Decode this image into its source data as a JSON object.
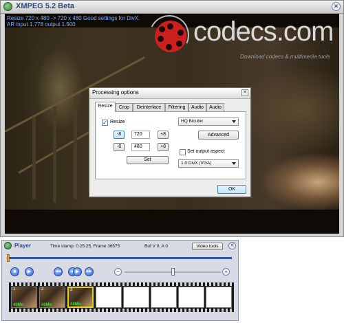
{
  "main_window": {
    "title": "XMPEG 5.2 Beta",
    "info_line1": "Resize 720 x 480 -> 720 x 480 Good settings for DivX.",
    "info_line2": "AR input 1.778 output 1.500"
  },
  "watermark": {
    "brand": "codecs.com",
    "tagline": "Download codecs & multimedia tools"
  },
  "dialog": {
    "title": "Processing options",
    "close_glyph": "✕",
    "tabs": [
      {
        "label": "Resize"
      },
      {
        "label": "Crop"
      },
      {
        "label": "Deinterlace"
      },
      {
        "label": "Filtering"
      },
      {
        "label": "Audio"
      },
      {
        "label": "Audio"
      }
    ],
    "resize_label": "Resize",
    "resize_checked_glyph": "✓",
    "minus8_label": "-8",
    "plus8_label": "+8",
    "width_value": "720",
    "height_value": "480",
    "set_button": "Set",
    "method_value": "HQ Bicubic",
    "advanced_button": "Advanced",
    "set_aspect_label": "Set output aspect",
    "aspect_value": "1.0 DivX (VGA)",
    "ok_button": "OK"
  },
  "player": {
    "title": "Player",
    "timestamp": "Time stamp: 0:25:25, Frame 36575",
    "buffer": "Buf V 0, A 0",
    "video_tools_button": "Video tools",
    "close_glyph": "✕",
    "seek_fraction": 0.0,
    "zoom_fraction": 0.5,
    "zoom_out_glyph": "−",
    "zoom_in_glyph": "+",
    "controls": [
      {
        "name": "stop",
        "glyph": "■"
      },
      {
        "name": "play",
        "glyph": "▶"
      },
      {
        "name": "rewind",
        "glyph": "◀◀"
      },
      {
        "name": "step-back",
        "glyph": "◀"
      },
      {
        "name": "step-forward",
        "glyph": "▶"
      },
      {
        "name": "fast-forward",
        "glyph": "▶▶"
      }
    ],
    "frames": [
      {
        "num": "1",
        "size": "40Mo"
      },
      {
        "num": "2",
        "size": "40Mo"
      },
      {
        "num": "3",
        "size": "40Mo"
      }
    ]
  }
}
